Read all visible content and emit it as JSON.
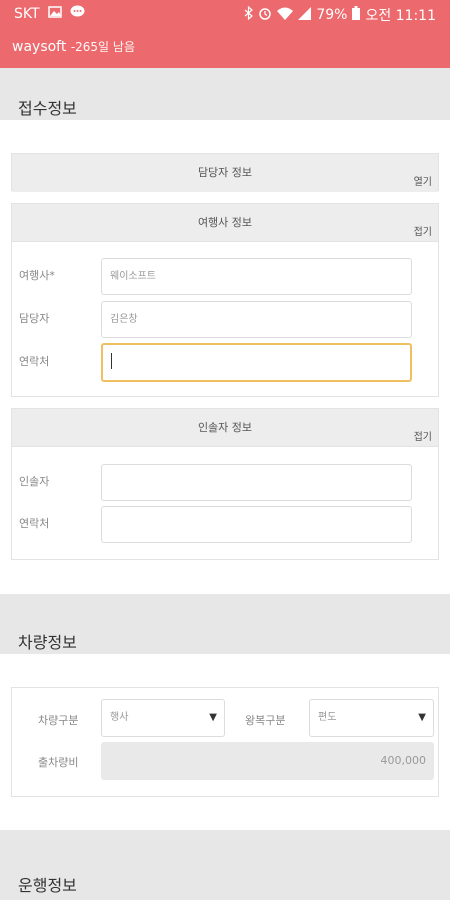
{
  "status_bar": {
    "carrier": "SKT",
    "battery": "79%",
    "time": "오전 11:11"
  },
  "app": {
    "name": "waysoft",
    "remaining": "-265일 남음"
  },
  "sections": {
    "reception": "접수정보",
    "vehicle": "차량정보",
    "operation": "운행정보"
  },
  "manager_card": {
    "title": "담당자 정보",
    "toggle": "열기"
  },
  "agency_card": {
    "title": "여행사 정보",
    "toggle": "접기",
    "fields": [
      {
        "label": "여행사*",
        "value": "웨이소프트"
      },
      {
        "label": "담당자",
        "value": "김은창"
      },
      {
        "label": "연락처",
        "value": ""
      }
    ]
  },
  "escort_card": {
    "title": "인솔자 정보",
    "toggle": "접기",
    "fields": [
      {
        "label": "인솔자",
        "value": ""
      },
      {
        "label": "연락처",
        "value": ""
      }
    ]
  },
  "vehicle_form": {
    "type_label": "차량구분",
    "type_value": "행사",
    "trip_label": "왕복구분",
    "trip_value": "편도",
    "fee_label": "출차량비",
    "fee_value": "400,000"
  },
  "colors": {
    "header": "#ec6a6d",
    "focus_border": "#f0c060",
    "band": "#e7e7e7"
  }
}
